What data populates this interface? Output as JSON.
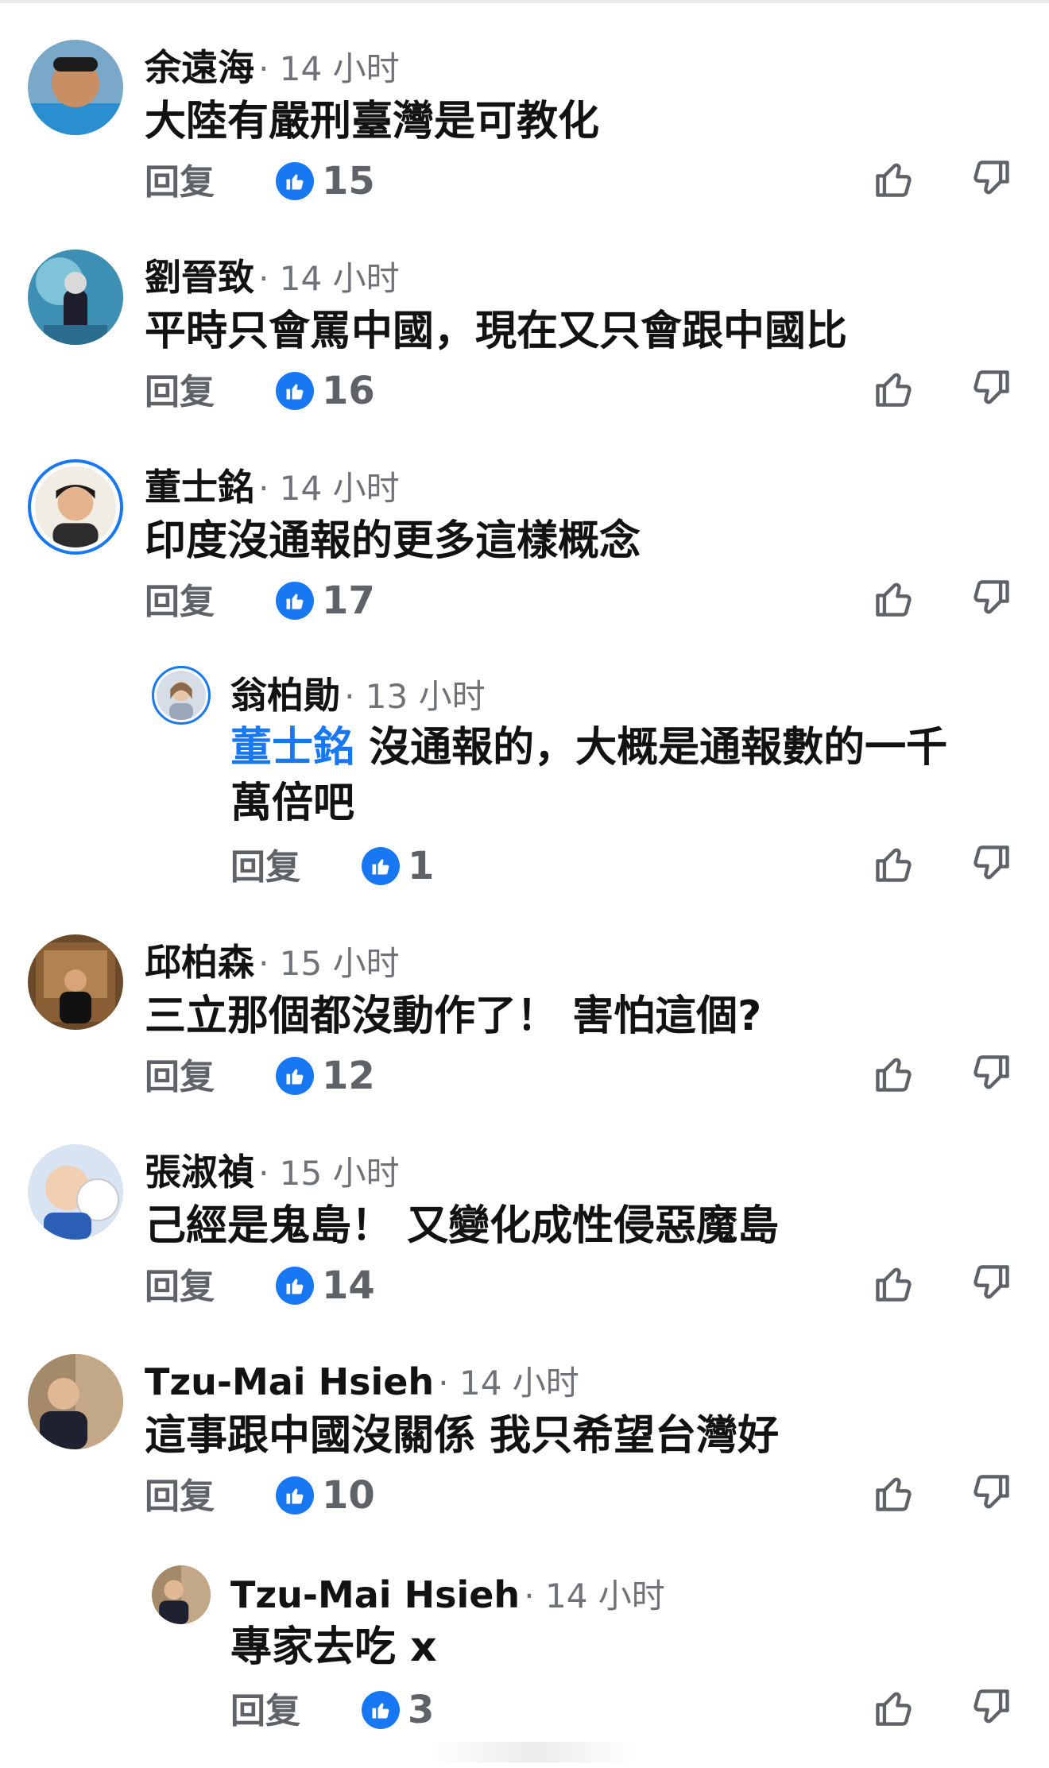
{
  "comments": [
    {
      "name": "余遠海",
      "time": "14 小时",
      "text": "大陸有嚴刑臺灣是可教化",
      "reply": "回复",
      "likes": "15"
    },
    {
      "name": "劉晉致",
      "time": "14 小时",
      "text": "平時只會罵中國，現在又只會跟中國比",
      "reply": "回复",
      "likes": "16"
    },
    {
      "name": "董士銘",
      "time": "14 小时",
      "text": "印度沒通報的更多這樣概念",
      "reply": "回复",
      "likes": "17"
    },
    {
      "name": "翁柏勛",
      "time": "13 小时",
      "mention": "董士銘",
      "text_line1": " 沒通報的，大概是通報數的一千",
      "text_line2": "萬倍吧",
      "reply": "回复",
      "likes": "1"
    },
    {
      "name": "邱柏森",
      "time": "15 小时",
      "text": "三立那個都沒動作了！ 害怕這個?",
      "reply": "回复",
      "likes": "12"
    },
    {
      "name": "張淑禎",
      "time": "15 小时",
      "text": "己經是鬼島！ 又變化成性侵惡魔島",
      "reply": "回复",
      "likes": "14"
    },
    {
      "name": "Tzu-Mai Hsieh",
      "time": "14 小时",
      "text": "這事跟中國沒關係 我只希望台灣好",
      "reply": "回复",
      "likes": "10"
    },
    {
      "name": "Tzu-Mai Hsieh",
      "time": "14 小时",
      "text": "專家去吃 x",
      "reply": "回复",
      "likes": "3"
    }
  ],
  "colors": {
    "accent": "#1877f2",
    "meta": "#6f7277",
    "text": "#101214"
  },
  "icons": {
    "like_badge": "thumbs-up-badge-icon",
    "like": "thumbs-up-outline-icon",
    "dislike": "thumbs-down-outline-icon"
  }
}
